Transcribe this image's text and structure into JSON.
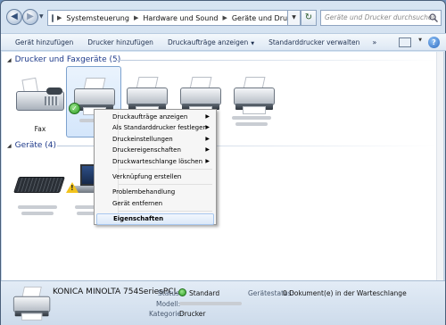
{
  "address_bar": {
    "crumbs": [
      "Systemsteuerung",
      "Hardware und Sound",
      "Geräte und Drucker"
    ]
  },
  "search": {
    "placeholder": "Geräte und Drucker durchsuchen"
  },
  "toolbar": {
    "add_device": "Gerät hinzufügen",
    "add_printer": "Drucker hinzufügen",
    "show_jobs": "Druckaufträge anzeigen",
    "manage_default": "Standarddrucker verwalten",
    "more": "»"
  },
  "groups": {
    "printers": {
      "title": "Drucker und Faxgeräte (5)"
    },
    "devices": {
      "title": "Geräte (4)"
    }
  },
  "printers": [
    {
      "label": "Fax",
      "icon": "fax-icon"
    },
    {
      "label": "",
      "icon": "printer-icon",
      "selected": true,
      "default": true
    },
    {
      "label": "",
      "icon": "printer-icon"
    },
    {
      "label": "",
      "icon": "printer-icon"
    },
    {
      "label": "",
      "icon": "printer-icon"
    }
  ],
  "context_menu": {
    "items": [
      "Druckaufträge anzeigen",
      "Als Standarddrucker festlegen",
      "Druckeinstellungen",
      "Druckereigenschaften",
      "Druckwarteschlange löschen",
      "Verknüpfung erstellen",
      "Problembehandlung",
      "Gerät entfernen",
      "Eigenschaften"
    ]
  },
  "details": {
    "name": "KONICA MINOLTA 754SeriesPCL",
    "status_label": "Status:",
    "status_value": "Standard",
    "model_label": "Modell:",
    "category_label": "Kategorie:",
    "category_value": "Drucker",
    "printer_status_label": "Gerätestatus:",
    "printer_status_value": "0 Dokument(e) in der Warteschlange"
  },
  "colors": {
    "group_header": "#1e3a8a",
    "selection": "#d4e6fb",
    "status_ok": "#2a9b22"
  }
}
